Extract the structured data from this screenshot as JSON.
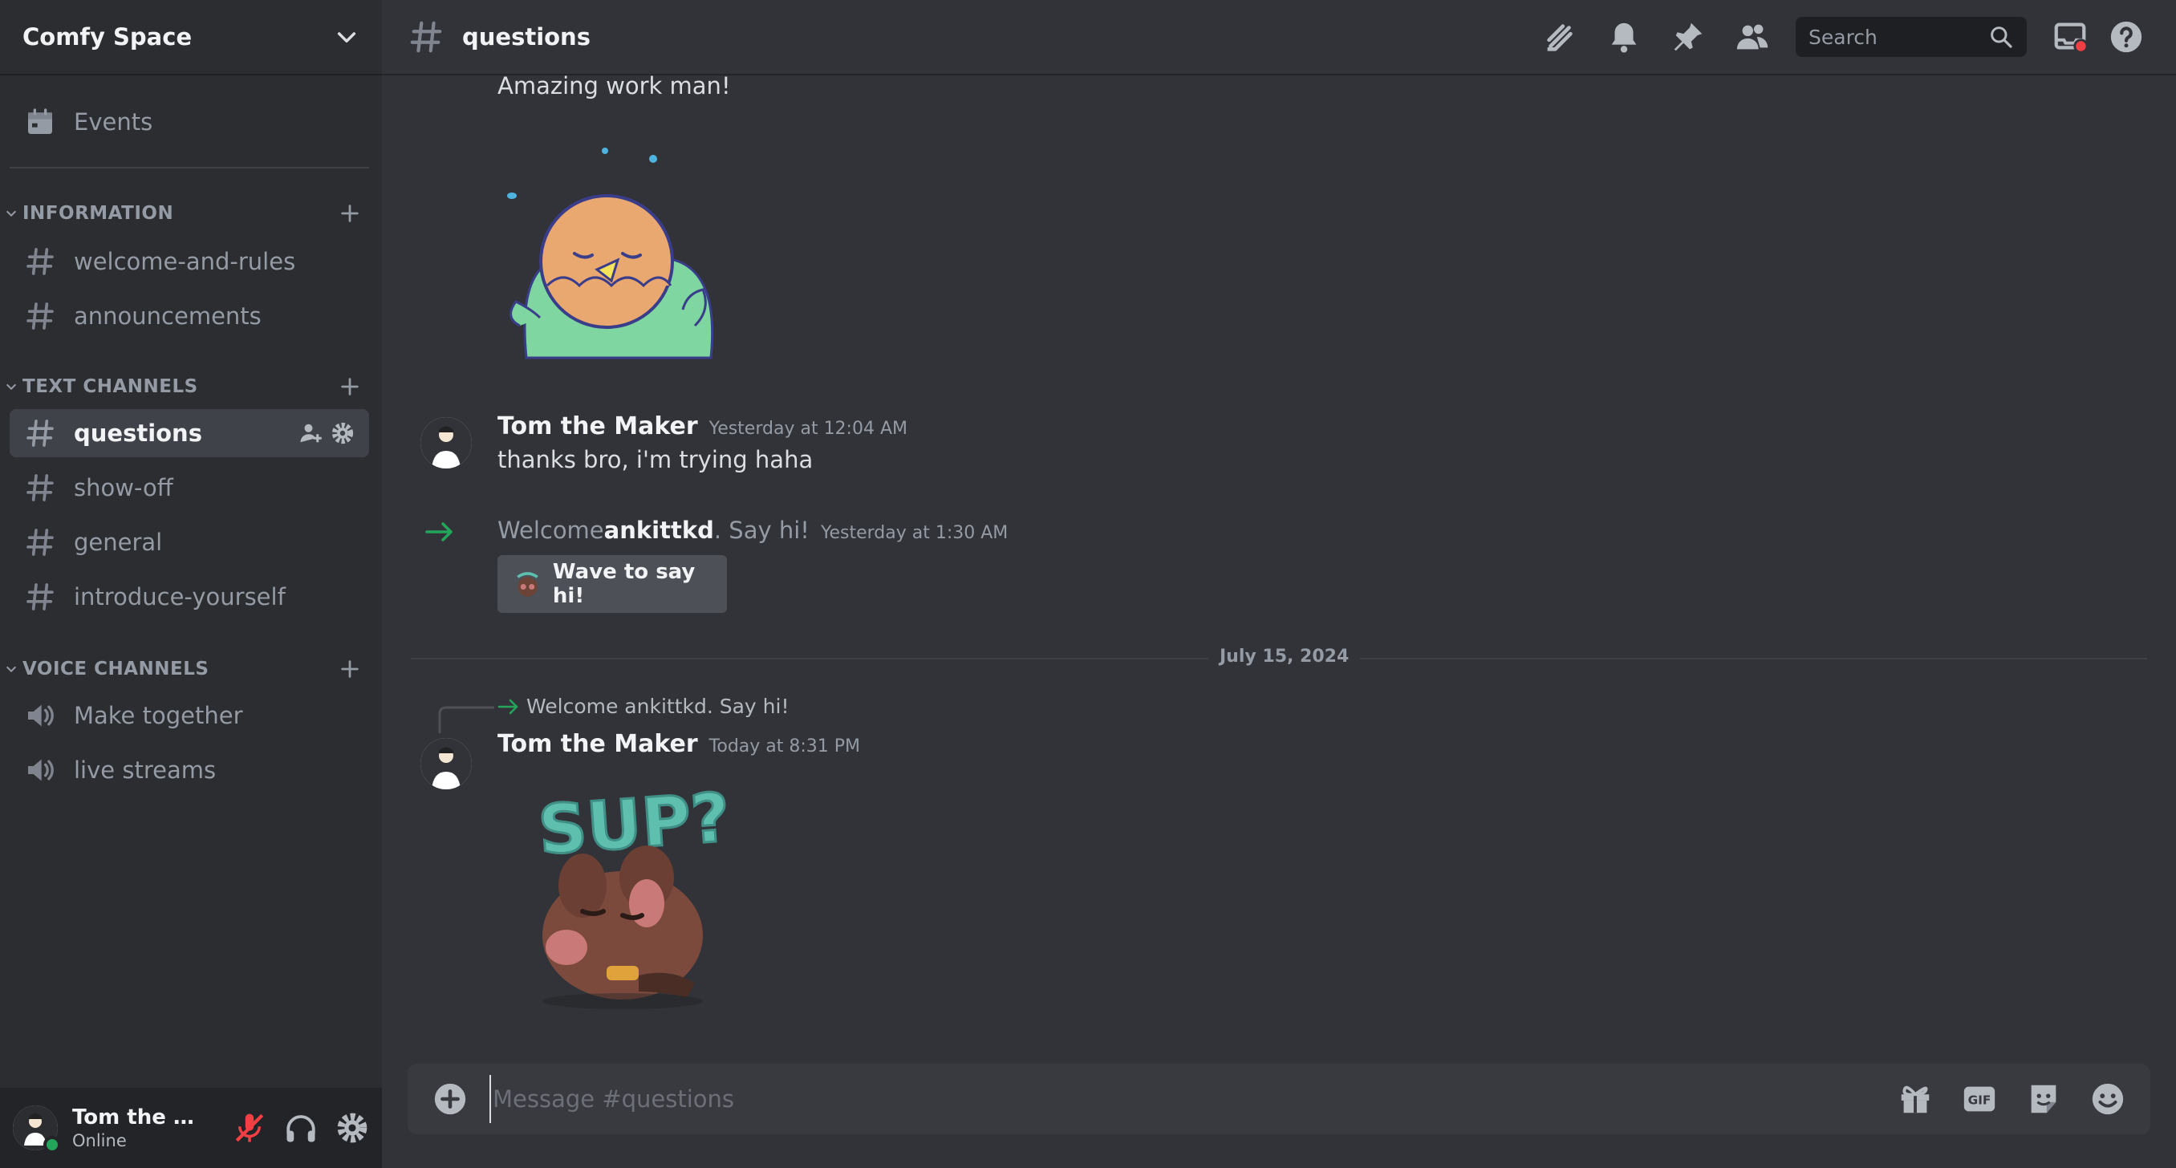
{
  "server": {
    "name": "Comfy Space"
  },
  "sidebar": {
    "events_label": "Events",
    "categories": [
      {
        "label": "INFORMATION",
        "channels": [
          "welcome-and-rules",
          "announcements"
        ]
      },
      {
        "label": "TEXT CHANNELS",
        "channels": [
          "questions",
          "show-off",
          "general",
          "introduce-yourself"
        ]
      },
      {
        "label": "VOICE CHANNELS",
        "channels": [
          "Make together",
          "live streams"
        ]
      }
    ],
    "active_channel": "questions"
  },
  "user": {
    "name": "Tom the M...",
    "status": "Online"
  },
  "header": {
    "channel": "questions",
    "search_placeholder": "Search"
  },
  "messages": {
    "continuation_text": "Amazing work man!",
    "msg1": {
      "author": "Tom the Maker",
      "timestamp": "Yesterday at 12:04 AM",
      "text": "thanks bro, i'm trying haha"
    },
    "system": {
      "prefix": "Welcome ",
      "username": "ankittkd",
      "suffix": ". Say hi!",
      "timestamp": "Yesterday at 1:30 AM",
      "button_label": "Wave to say hi!"
    },
    "date_divider": "July 15, 2024",
    "reply_preview": "Welcome ankittkd. Say hi!",
    "msg2": {
      "author": "Tom the Maker",
      "timestamp": "Today at 8:31 PM",
      "sticker_text": "SUP?"
    }
  },
  "composer": {
    "placeholder": "Message #questions",
    "gif_label": "GIF"
  },
  "colors": {
    "background": "#313338",
    "sidebar": "#2b2d31",
    "accent_green": "#23a55a",
    "mute_red": "#f23f43"
  }
}
